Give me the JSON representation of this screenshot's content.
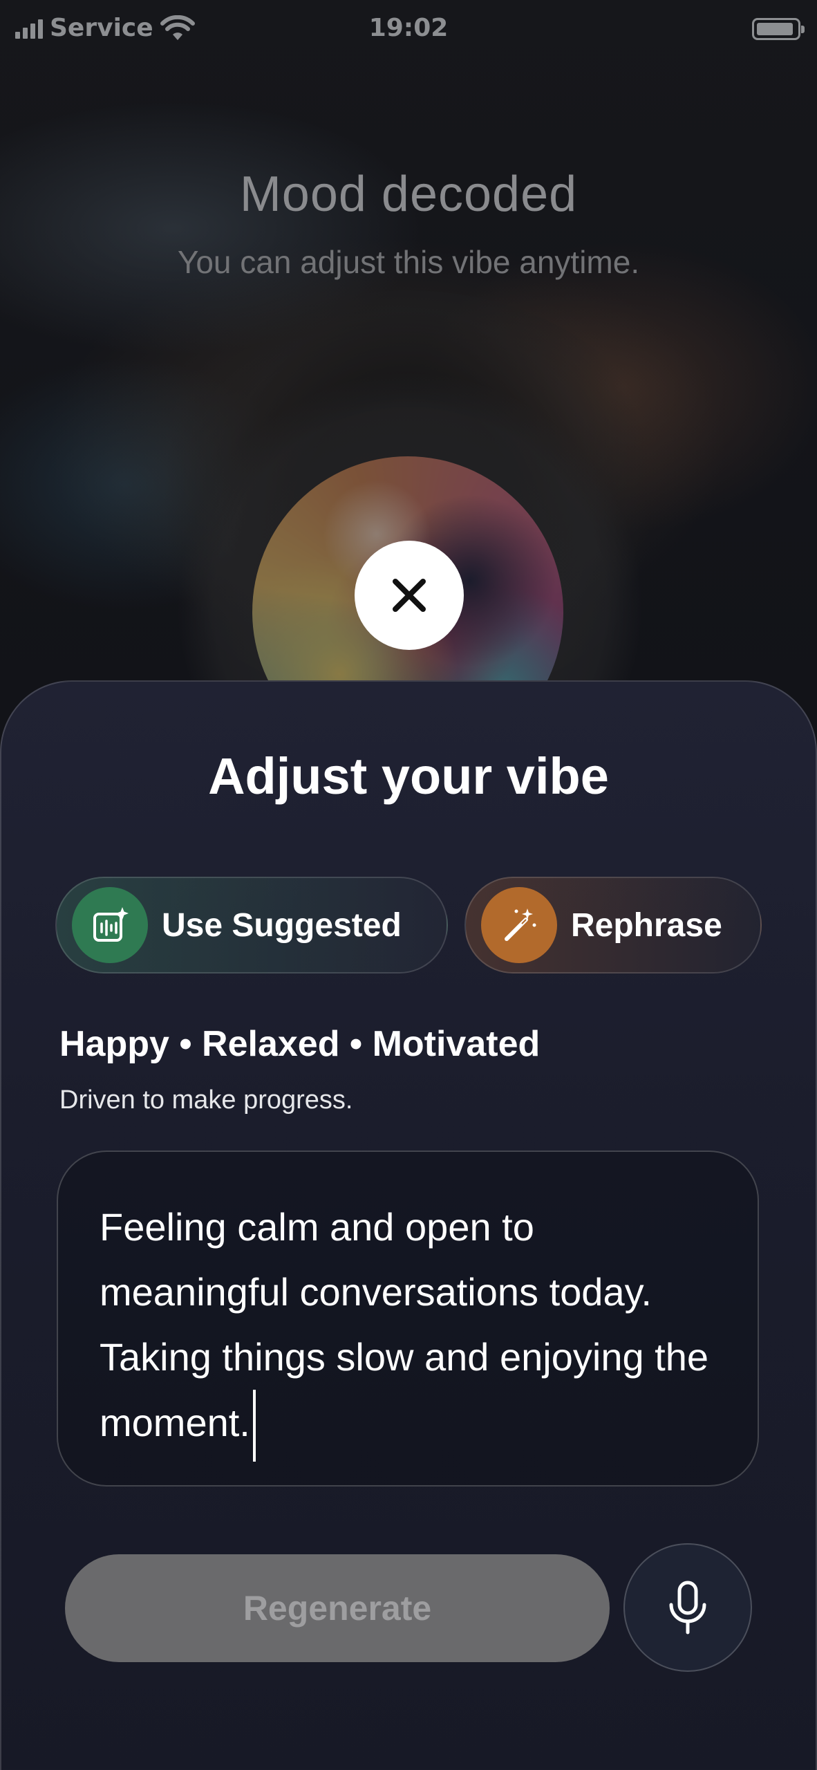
{
  "status_bar": {
    "carrier": "Service",
    "time": "19:02"
  },
  "header": {
    "title": "Mood decoded",
    "subtitle": "You can adjust this vibe anytime."
  },
  "sheet": {
    "title": "Adjust your vibe",
    "actions": {
      "use_suggested_label": "Use Suggested",
      "rephrase_label": "Rephrase"
    },
    "mood_tags": "Happy • Relaxed • Motivated",
    "mood_description": "Driven to make progress.",
    "vibe_text": "Feeling calm and open to meaningful conversations today. Taking things slow and enjoying the moment.",
    "regenerate_label": "Regenerate"
  },
  "icons": {
    "close": "close-icon",
    "use_suggested": "sparkle-chart-icon",
    "rephrase": "magic-wand-icon",
    "microphone": "microphone-icon",
    "signal": "signal-icon",
    "wifi": "wifi-icon",
    "battery": "battery-icon"
  },
  "colors": {
    "suggested_icon_bg": "#2f7a52",
    "rephrase_icon_bg": "#b26a2c",
    "regenerate_bg": "#6a6a6c",
    "sheet_bg": "#1b1d2c"
  }
}
